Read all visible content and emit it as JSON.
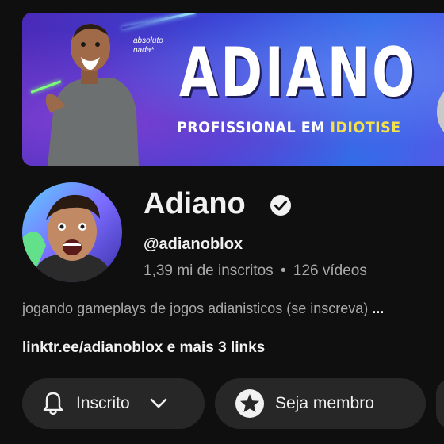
{
  "banner": {
    "tagline": "absoluto nada*",
    "title": "ADIANO",
    "subtitle_main": "PROFISSIONAL EM ",
    "subtitle_highlight": "IDIOTISE"
  },
  "channel": {
    "name": "Adiano",
    "handle": "@adianoblox",
    "subscribers": "1,39 mi de inscritos",
    "separator": "•",
    "videos": "126 vídeos",
    "description": "jogando gameplays de jogos adianisticos (se inscreva) ",
    "description_more": "...",
    "link": "linktr.ee/adianoblox",
    "links_more": " e mais 3 links"
  },
  "buttons": {
    "subscribed_label": "Inscrito",
    "member_label": "Seja membro"
  },
  "icons": {
    "verified": "check-circle-icon",
    "bell": "bell-icon",
    "chevron": "chevron-down-icon",
    "star": "star-badge-icon"
  },
  "colors": {
    "background": "#0f0f0f",
    "button_bg": "#272727",
    "secondary_text": "#aaaaaa",
    "highlight_yellow": "#f5e14a"
  }
}
